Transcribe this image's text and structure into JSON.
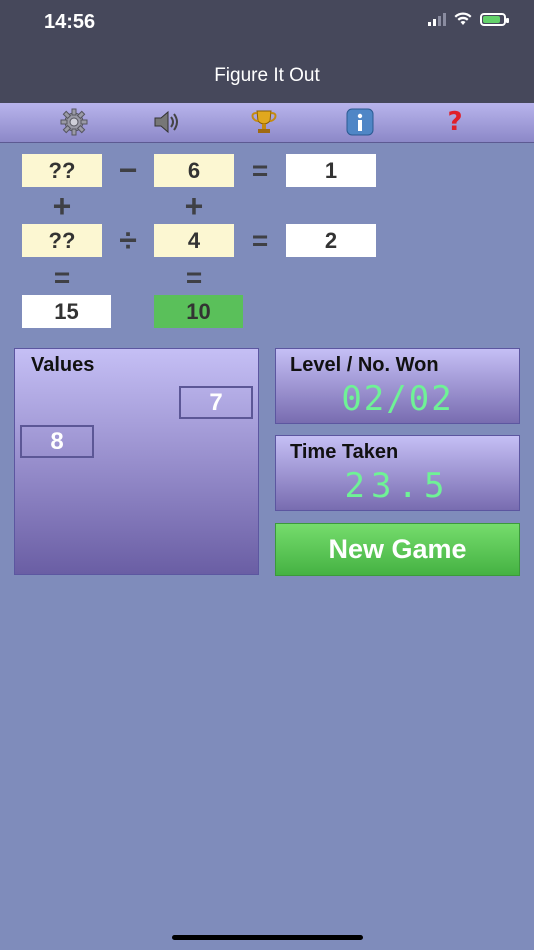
{
  "status": {
    "time": "14:56"
  },
  "nav": {
    "title": "Figure It Out"
  },
  "toolbar": {
    "icons": [
      "gear-icon",
      "speaker-icon",
      "trophy-icon",
      "info-icon",
      "help-icon"
    ],
    "help_glyph": "?",
    "info_glyph": "i"
  },
  "puzzle": {
    "row1": {
      "a": "??",
      "op": "−",
      "b": "6",
      "eq": "=",
      "result": "1"
    },
    "col_ops": {
      "left": "+",
      "right": "+"
    },
    "row2": {
      "a": "??",
      "op": "÷",
      "b": "4",
      "eq": "=",
      "result": "2"
    },
    "col_eq": {
      "left": "=",
      "right": "="
    },
    "col_results": {
      "left": "15",
      "right": "10"
    }
  },
  "values": {
    "title": "Values",
    "tiles": [
      "7",
      "8"
    ]
  },
  "level": {
    "label": "Level / No. Won",
    "value": "02/02"
  },
  "time_taken": {
    "label": "Time Taken",
    "value": "23.5"
  },
  "buttons": {
    "new_game": "New Game"
  },
  "colors": {
    "background": "#7f8cbb",
    "header": "#46485b",
    "digital_green": "#6ff296",
    "button_green": "#5ac05a",
    "cell_yellow": "#fcf7d2"
  }
}
